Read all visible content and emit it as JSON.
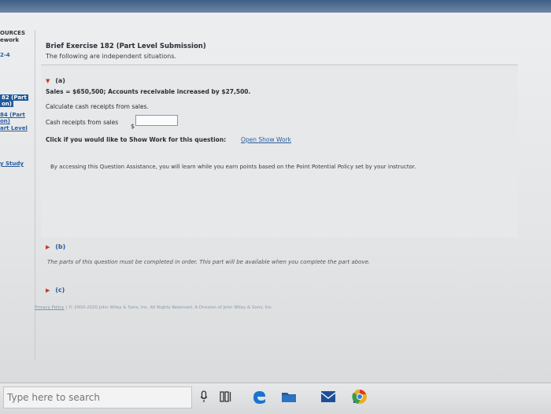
{
  "leftnav": {
    "header_1": "OURCES",
    "header_2": "ework",
    "item_range": "2-4",
    "link_1_line1": "82 (Part",
    "link_1_line2": "on)",
    "link_2_line1": "84 (Part",
    "link_2_line2": "on)",
    "link_3": "art Level",
    "link_4": "y Study"
  },
  "exercise": {
    "title": "Brief Exercise 182 (Part Level Submission)",
    "subtitle": "The following are independent situations."
  },
  "part_a": {
    "label": "(a)",
    "given": "Sales = $650,500; Accounts receivable increased by $27,500.",
    "instruction": "Calculate cash receipts from sales.",
    "field_label": "Cash receipts from sales",
    "currency": "$",
    "field_value": "",
    "show_work_prompt": "Click if you would like to Show Work for this question:",
    "show_work_link": "Open Show Work",
    "assistance_note": "By accessing this Question Assistance, you will learn while you earn points based on the Point Potential Policy set by your instructor."
  },
  "part_b": {
    "label": "(b)",
    "note": "The parts of this question must be completed in order. This part will be available when you complete the part above."
  },
  "part_c": {
    "label": "(c)"
  },
  "footer": {
    "privacy": "Privacy Policy",
    "copyright": "© 2000-2020 John Wiley & Sons, Inc. All Rights Reserved. A Division of John Wiley & Sons, Inc."
  },
  "taskbar": {
    "search_placeholder": "Type here to search"
  }
}
